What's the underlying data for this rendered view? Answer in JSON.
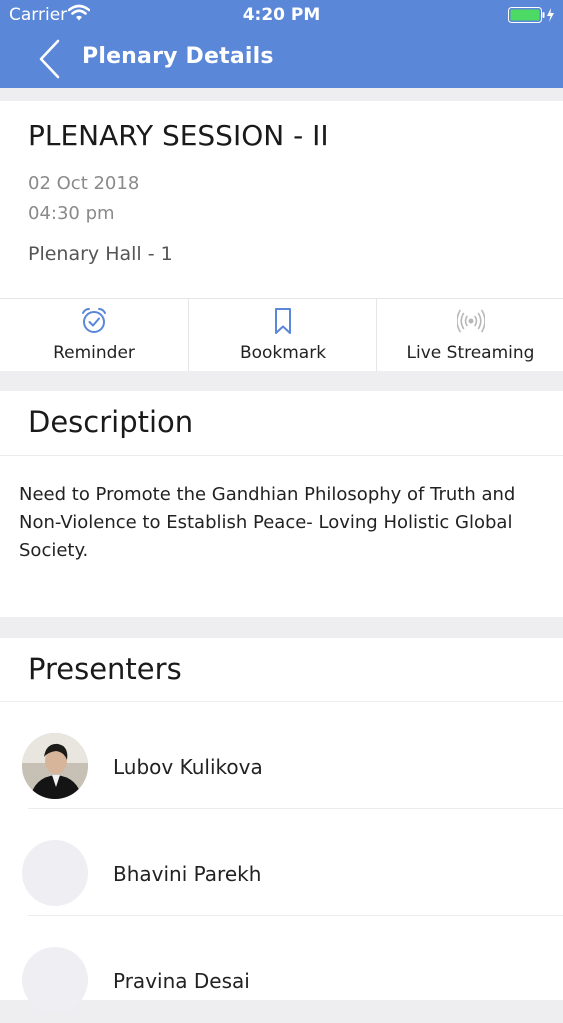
{
  "status_bar": {
    "carrier": "Carrier",
    "time": "4:20 PM"
  },
  "nav": {
    "title": "Plenary Details"
  },
  "session": {
    "title": "PLENARY SESSION - II",
    "date": "02 Oct 2018",
    "time": "04:30 pm",
    "venue": "Plenary Hall - 1"
  },
  "actions": [
    {
      "label": "Reminder",
      "icon": "alarm-clock-icon"
    },
    {
      "label": "Bookmark",
      "icon": "bookmark-icon"
    },
    {
      "label": "Live Streaming",
      "icon": "broadcast-icon"
    }
  ],
  "description": {
    "heading": "Description",
    "text": "Need to Promote the Gandhian Philosophy of Truth and Non-Violence to Establish Peace- Loving Holistic Global Society."
  },
  "presenters": {
    "heading": "Presenters",
    "items": [
      {
        "name": "Lubov Kulikova"
      },
      {
        "name": "Bhavini Parekh"
      },
      {
        "name": "Pravina Desai"
      }
    ]
  },
  "colors": {
    "header": "#5b87d8",
    "icon_active": "#5b87d8",
    "icon_disabled": "#b8b8b8"
  }
}
